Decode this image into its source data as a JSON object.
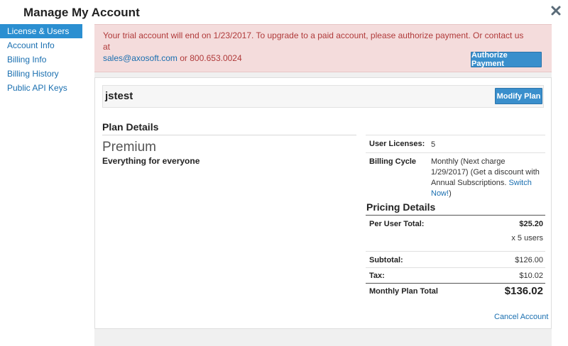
{
  "header": {
    "title": "Manage My Account"
  },
  "sidebar": {
    "items": [
      {
        "label": "License & Users",
        "active": true
      },
      {
        "label": "Account Info",
        "active": false
      },
      {
        "label": "Billing Info",
        "active": false
      },
      {
        "label": "Billing History",
        "active": false
      },
      {
        "label": "Public API Keys",
        "active": false
      }
    ]
  },
  "alert": {
    "message": "Your trial account will end on 1/23/2017. To upgrade to a paid account, please authorize payment. Or contact us at",
    "email": "sales@axosoft.com",
    "or_text": " or ",
    "phone": "800.653.0024",
    "button_label": "Authorize Payment"
  },
  "account": {
    "name": "jstest",
    "modify_label": "Modify Plan"
  },
  "plan": {
    "heading": "Plan Details",
    "name": "Premium",
    "description": "Everything for everyone"
  },
  "details": {
    "user_licenses_label": "User Licenses:",
    "user_licenses_value": "5",
    "billing_cycle_label": "Billing Cycle",
    "billing_cycle_text": "Monthly (Next charge 1/29/2017) (Get a discount with Annual Subscriptions. ",
    "billing_cycle_link": "Switch Now!",
    "billing_cycle_tail": ")"
  },
  "pricing": {
    "heading": "Pricing Details",
    "per_user_label": "Per User Total:",
    "per_user_value": "$25.20",
    "per_user_multiplier": "x 5 users",
    "subtotal_label": "Subtotal:",
    "subtotal_value": "$126.00",
    "tax_label": "Tax:",
    "tax_value": "$10.02",
    "total_label": "Monthly Plan Total",
    "total_value": "$136.02"
  },
  "footer": {
    "cancel_label": "Cancel Account"
  },
  "colors": {
    "accent": "#2b8fd1",
    "button": "#3a8fcc",
    "alert_bg": "#f4dcdc",
    "alert_text": "#b03a3a",
    "link": "#1a6fb0"
  }
}
